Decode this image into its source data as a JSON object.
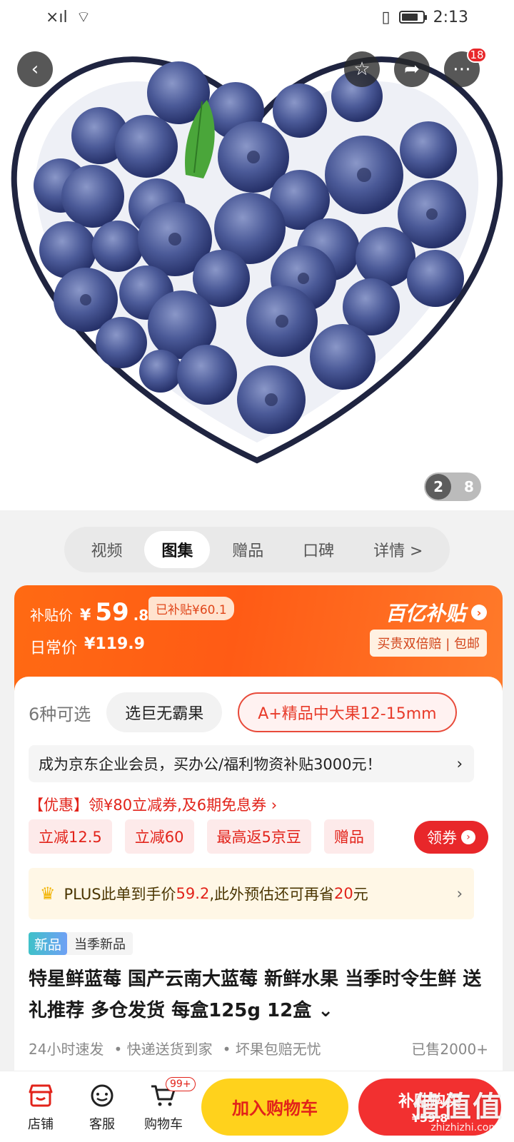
{
  "status_bar": {
    "time": "2:13",
    "signal": "×ıl",
    "wifi": "⌔",
    "vibrate": "▯"
  },
  "topbar": {
    "cart_badge": "18"
  },
  "gallery": {
    "current": "2",
    "total": "8"
  },
  "tabs": [
    {
      "label": "视频"
    },
    {
      "label": "图集"
    },
    {
      "label": "赠品"
    },
    {
      "label": "口碑"
    },
    {
      "label": "详情 >"
    }
  ],
  "price": {
    "subsidy_label": "补贴价",
    "currency": "¥",
    "subsidy_int": "59",
    "subsidy_dec": ".8",
    "subsidized_tag": "已补贴¥60.1",
    "daily_label": "日常价",
    "daily_value": "¥119.9",
    "brand": "百亿补贴",
    "brand_sub": "买贵双倍赔 | 包邮"
  },
  "variants": {
    "count": "6种可选",
    "options": [
      "选巨无霸果",
      "A+精品中大果12-15mm"
    ]
  },
  "enterprise_bar": {
    "text": "成为京东企业会员，买办公/福利物资补贴3000元！",
    "chev": "›"
  },
  "promo": {
    "text": "【优惠】领¥80立减券,及6期免息券 ›"
  },
  "chips": [
    "立减12.5",
    "立减60",
    "最高返5京豆",
    "赠品"
  ],
  "coupon_button": {
    "label": "领券"
  },
  "plus": {
    "prefix": "PLUS此单到手价",
    "price": "59.2",
    "middle": ",此外预估还可再省",
    "save": "20",
    "suffix": "元",
    "chev": "›"
  },
  "new_tag": {
    "badge": "新品",
    "label": "当季新品"
  },
  "product": {
    "title": "特星鲜蓝莓 国产云南大蓝莓 新鲜水果 当季时令生鲜 送礼推荐 多仓发货 每盒125g 12盒 ⌄"
  },
  "meta": {
    "items": [
      "24小时速发",
      "• 快递送货到家",
      "• 坏果包赔无忧"
    ],
    "sold": "已售2000+"
  },
  "bottom_bar": {
    "shop": "店铺",
    "service": "客服",
    "cart": "购物车",
    "cart_badge": "99+",
    "add_to_cart": "加入购物车",
    "buy_l1": "补贴购买",
    "buy_l2": "¥59.8"
  },
  "watermark": {
    "main": "值值值",
    "sub": "zhizhizhi.com"
  },
  "colors": {
    "accent": "#ff5b15",
    "red": "#e2231a",
    "yellow": "#ffd21c",
    "berry": "#4a5a9a"
  }
}
